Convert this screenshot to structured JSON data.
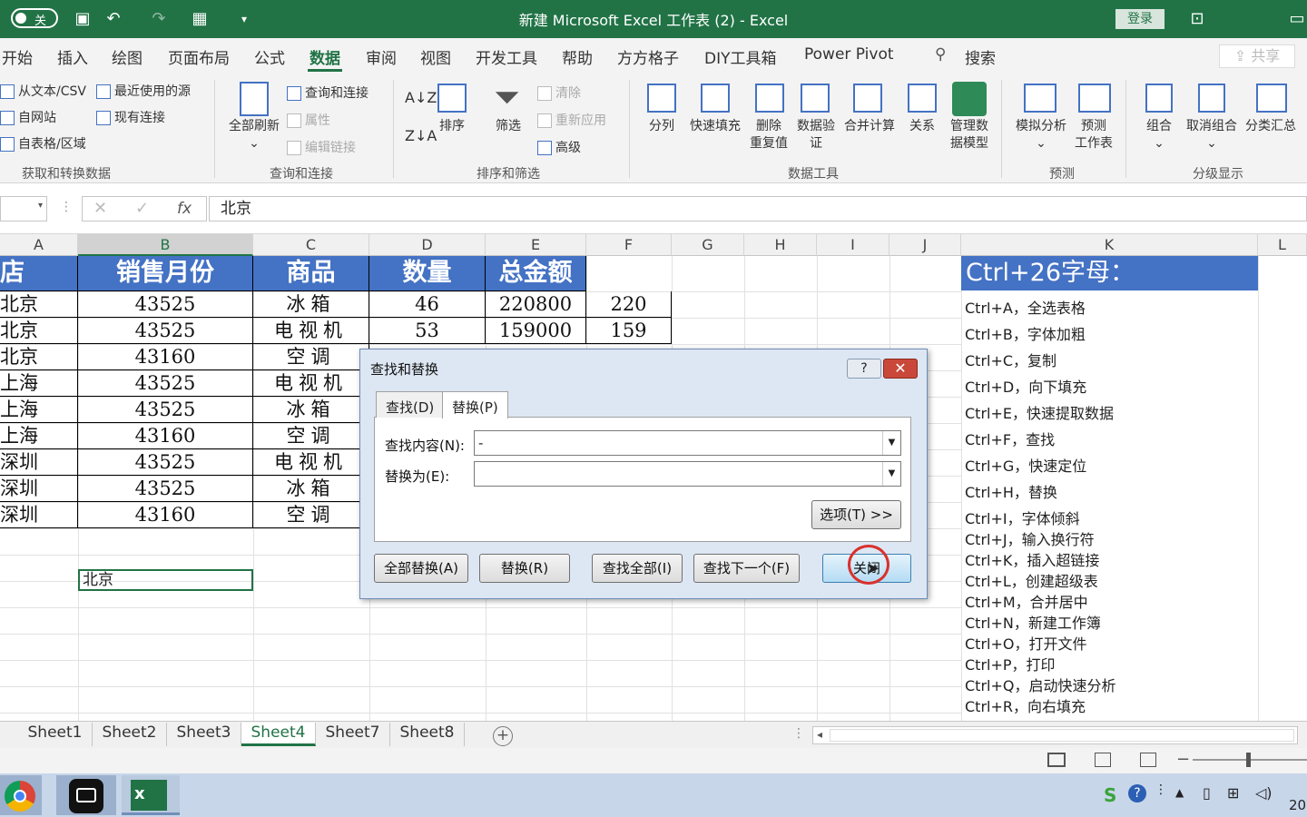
{
  "titlebar": {
    "title": "新建 Microsoft Excel 工作表 (2)  -  Excel",
    "autosave_label": "关",
    "login_label": "登录"
  },
  "ribbon_tabs": [
    "开始",
    "插入",
    "绘图",
    "页面布局",
    "公式",
    "数据",
    "审阅",
    "视图",
    "开发工具",
    "帮助",
    "方方格子",
    "DIY工具箱",
    "Power Pivot"
  ],
  "active_tab": "数据",
  "search_label": "搜索",
  "share_label": "共享",
  "ribbon": {
    "get_data": {
      "items": [
        "从文本/CSV",
        "自网站",
        "自表格/区域",
        "最近使用的源",
        "现有连接"
      ],
      "group": "获取和转换数据"
    },
    "queries": {
      "refresh": "全部刷新",
      "items": [
        "查询和连接",
        "属性",
        "编辑链接"
      ],
      "group": "查询和连接"
    },
    "sort": {
      "sort": "排序",
      "filter": "筛选",
      "items": [
        "清除",
        "重新应用",
        "高级"
      ],
      "group": "排序和筛选"
    },
    "data_tools": {
      "items": [
        "分列",
        "快速填充",
        "删除\n重复值",
        "数据验\n证",
        "合并计算",
        "关系",
        "管理数\n据模型"
      ],
      "group": "数据工具"
    },
    "forecast": {
      "items": [
        "模拟分析",
        "预测\n工作表"
      ],
      "group": "预测"
    },
    "outline": {
      "items": [
        "组合",
        "取消组合",
        "分类汇总"
      ],
      "group": "分级显示"
    }
  },
  "formula_bar": {
    "value": "北京",
    "fx": "fx"
  },
  "columns": [
    "A",
    "B",
    "C",
    "D",
    "E",
    "F",
    "G",
    "H",
    "I",
    "J",
    "K",
    "L"
  ],
  "table": {
    "headers": [
      "店",
      "销售月份",
      "商品",
      "数量",
      "总金额"
    ],
    "rows": [
      [
        "北京",
        "43525",
        "冰箱",
        "46",
        "220800",
        "220"
      ],
      [
        "北京",
        "43525",
        "电视机",
        "53",
        "159000",
        "159"
      ],
      [
        "北京",
        "43160",
        "空调",
        "",
        "",
        ""
      ],
      [
        "上海",
        "43525",
        "电视机",
        "",
        "",
        ""
      ],
      [
        "上海",
        "43525",
        "冰箱",
        "",
        "",
        ""
      ],
      [
        "上海",
        "43160",
        "空调",
        "",
        "",
        ""
      ],
      [
        "深圳",
        "43525",
        "电视机",
        "",
        "",
        ""
      ],
      [
        "深圳",
        "43525",
        "冰箱",
        "",
        "",
        ""
      ],
      [
        "深圳",
        "43160",
        "空调",
        "",
        "",
        ""
      ]
    ]
  },
  "selected_cell_value": "北京",
  "shortcuts": {
    "title": "Ctrl+26字母：",
    "items": [
      "Ctrl+A，全选表格",
      "Ctrl+B，字体加粗",
      "Ctrl+C，复制",
      "Ctrl+D，向下填充",
      "Ctrl+E，快速提取数据",
      "Ctrl+F，查找",
      "Ctrl+G，快速定位",
      "Ctrl+H，替换",
      "Ctrl+I，字体倾斜",
      "Ctrl+J，输入换行符",
      "Ctrl+K，插入超链接",
      "Ctrl+L，创建超级表",
      "Ctrl+M，合并居中",
      "Ctrl+N，新建工作簿",
      "Ctrl+O，打开文件",
      "Ctrl+P，打印",
      "Ctrl+Q，启动快速分析",
      "Ctrl+R，向右填充"
    ]
  },
  "sheets": [
    "Sheet1",
    "Sheet2",
    "Sheet3",
    "Sheet4",
    "Sheet7",
    "Sheet8"
  ],
  "active_sheet": "Sheet4",
  "dialog": {
    "title": "查找和替换",
    "help": "?",
    "tab_find": "查找(D)",
    "tab_replace": "替换(P)",
    "find_label": "查找内容(N):",
    "find_value": "-",
    "replace_label": "替换为(E):",
    "replace_value": "",
    "options_button": "选项(T) >>",
    "buttons": {
      "replace_all": "全部替换(A)",
      "replace": "替换(R)",
      "find_all": "查找全部(I)",
      "find_next": "查找下一个(F)",
      "close": "关闭"
    }
  },
  "taskbar": {
    "clock_partial": "20"
  }
}
